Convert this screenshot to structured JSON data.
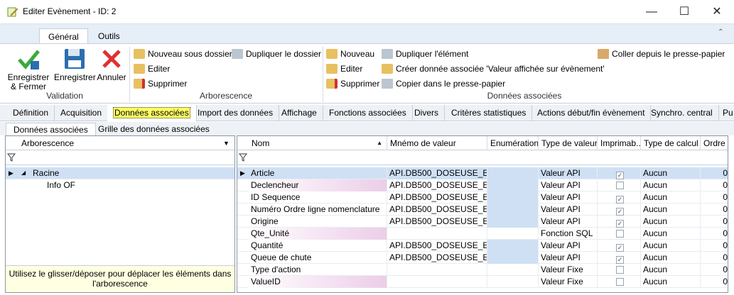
{
  "window": {
    "title": "Editer Evènement - ID: 2"
  },
  "ribbon": {
    "tabs": [
      "Général",
      "Outils"
    ],
    "validation": {
      "save_close": "Enregistrer\n& Fermer",
      "save": "Enregistrer",
      "cancel": "Annuler",
      "group": "Validation"
    },
    "arbo": {
      "new_sub": "Nouveau sous dossier",
      "edit": "Editer",
      "delete": "Supprimer",
      "dup_folder": "Dupliquer le dossier",
      "group": "Arborescence"
    },
    "assoc": {
      "new": "Nouveau",
      "edit": "Editer",
      "delete": "Supprimer",
      "dup_elem": "Dupliquer l'élément",
      "create_assoc": "Créer donnée associée 'Valeur affichée sur évènement'",
      "copy": "Copier dans le presse-papier",
      "paste": "Coller depuis le presse-papier",
      "group": "Données associées"
    }
  },
  "main_tabs": [
    "Définition",
    "Acquisition",
    "Données associées",
    "Import des données",
    "Affichage",
    "Fonctions associées",
    "Divers",
    "Critères statistiques",
    "Actions début/fin évènement",
    "Synchro. central",
    "Pu"
  ],
  "sub_tabs": [
    "Données associées",
    "Grille des données associées"
  ],
  "tree": {
    "header": "Arborescence",
    "root": "Racine",
    "child": "Info OF",
    "hint": "Utilisez le glisser/déposer pour déplacer les éléments dans l'arborescence"
  },
  "grid": {
    "columns": [
      "Nom",
      "Mnémo de valeur",
      "Enumération",
      "Type de valeur",
      "Imprimab...",
      "Type de calcul",
      "Ordre"
    ],
    "rows": [
      {
        "nom": "Article",
        "mnemo": "API.DB500_DOSEUSE_E...",
        "enum": "",
        "type": "Valeur API",
        "imp": true,
        "calc": "Aucun",
        "ordre": "0"
      },
      {
        "nom": "Declencheur",
        "mnemo": "API.DB500_DOSEUSE_E...",
        "enum": "",
        "type": "Valeur API",
        "imp": false,
        "calc": "Aucun",
        "ordre": "0"
      },
      {
        "nom": "ID Sequence",
        "mnemo": "API.DB500_DOSEUSE_E...",
        "enum": "",
        "type": "Valeur API",
        "imp": true,
        "calc": "Aucun",
        "ordre": "0"
      },
      {
        "nom": "Numéro Ordre ligne nomenclature",
        "mnemo": "API.DB500_DOSEUSE_E...",
        "enum": "",
        "type": "Valeur API",
        "imp": true,
        "calc": "Aucun",
        "ordre": "0"
      },
      {
        "nom": "Origine",
        "mnemo": "API.DB500_DOSEUSE_E...",
        "enum": "",
        "type": "Valeur API",
        "imp": true,
        "calc": "Aucun",
        "ordre": "0"
      },
      {
        "nom": "Qte_Unité",
        "mnemo": "",
        "enum": "",
        "type": "Fonction SQL",
        "imp": false,
        "calc": "Aucun",
        "ordre": "0"
      },
      {
        "nom": "Quantité",
        "mnemo": "API.DB500_DOSEUSE_E...",
        "enum": "",
        "type": "Valeur API",
        "imp": true,
        "calc": "Aucun",
        "ordre": "0"
      },
      {
        "nom": "Queue de chute",
        "mnemo": "API.DB500_DOSEUSE_E...",
        "enum": "",
        "type": "Valeur API",
        "imp": true,
        "calc": "Aucun",
        "ordre": "0"
      },
      {
        "nom": "Type d'action",
        "mnemo": "",
        "enum": "",
        "type": "Valeur Fixe",
        "imp": false,
        "calc": "Aucun",
        "ordre": "0"
      },
      {
        "nom": "ValueID",
        "mnemo": "",
        "enum": "",
        "type": "Valeur Fixe",
        "imp": false,
        "calc": "Aucun",
        "ordre": "0"
      }
    ]
  }
}
